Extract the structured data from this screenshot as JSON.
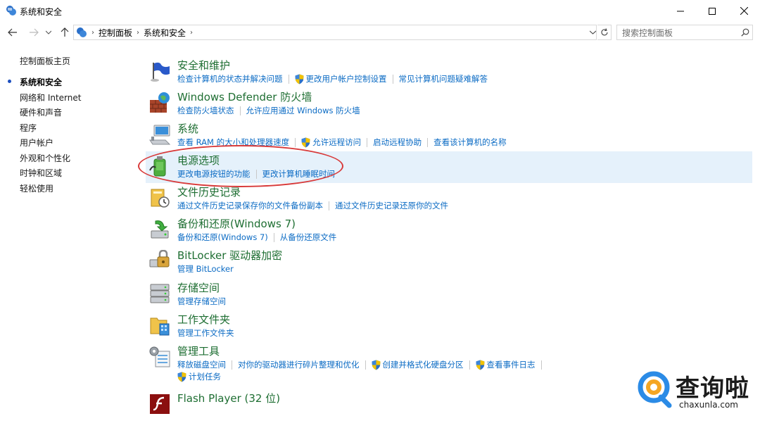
{
  "window": {
    "title": "系统和安全"
  },
  "address": {
    "crumbs": [
      "控制面板",
      "系统和安全"
    ]
  },
  "search": {
    "placeholder": "搜索控制面板"
  },
  "sidebar": {
    "items": [
      {
        "label": "控制面板主页",
        "active": false
      },
      {
        "label": "系统和安全",
        "active": true
      },
      {
        "label": "网络和 Internet",
        "active": false
      },
      {
        "label": "硬件和声音",
        "active": false
      },
      {
        "label": "程序",
        "active": false
      },
      {
        "label": "用户帐户",
        "active": false
      },
      {
        "label": "外观和个性化",
        "active": false
      },
      {
        "label": "时钟和区域",
        "active": false
      },
      {
        "label": "轻松使用",
        "active": false
      }
    ]
  },
  "categories": [
    {
      "icon": "flag-icon",
      "title": "安全和维护",
      "links": [
        {
          "label": "检查计算机的状态并解决问题",
          "shield": false
        },
        {
          "label": "更改用户帐户控制设置",
          "shield": true
        },
        {
          "label": "常见计算机问题疑难解答",
          "shield": false
        }
      ]
    },
    {
      "icon": "firewall-icon",
      "title": "Windows Defender 防火墙",
      "links": [
        {
          "label": "检查防火墙状态",
          "shield": false
        },
        {
          "label": "允许应用通过 Windows 防火墙",
          "shield": false
        }
      ]
    },
    {
      "icon": "computer-icon",
      "title": "系统",
      "links": [
        {
          "label": "查看 RAM 的大小和处理器速度",
          "shield": false
        },
        {
          "label": "允许远程访问",
          "shield": true
        },
        {
          "label": "启动远程协助",
          "shield": false
        },
        {
          "label": "查看该计算机的名称",
          "shield": false
        }
      ]
    },
    {
      "icon": "power-icon",
      "title": "电源选项",
      "highlighted": true,
      "links": [
        {
          "label": "更改电源按钮的功能",
          "shield": false
        },
        {
          "label": "更改计算机睡眠时间",
          "shield": false
        }
      ]
    },
    {
      "icon": "file-history-icon",
      "title": "文件历史记录",
      "links": [
        {
          "label": "通过文件历史记录保存你的文件备份副本",
          "shield": false
        },
        {
          "label": "通过文件历史记录还原你的文件",
          "shield": false
        }
      ]
    },
    {
      "icon": "backup-icon",
      "title": "备份和还原(Windows 7)",
      "links": [
        {
          "label": "备份和还原(Windows 7)",
          "shield": false
        },
        {
          "label": "从备份还原文件",
          "shield": false
        }
      ]
    },
    {
      "icon": "bitlocker-icon",
      "title": "BitLocker 驱动器加密",
      "links": [
        {
          "label": "管理 BitLocker",
          "shield": false
        }
      ]
    },
    {
      "icon": "storage-icon",
      "title": "存储空间",
      "links": [
        {
          "label": "管理存储空间",
          "shield": false
        }
      ]
    },
    {
      "icon": "work-folder-icon",
      "title": "工作文件夹",
      "links": [
        {
          "label": "管理工作文件夹",
          "shield": false
        }
      ]
    },
    {
      "icon": "admin-tools-icon",
      "title": "管理工具",
      "links": [
        {
          "label": "释放磁盘空间",
          "shield": false
        },
        {
          "label": "对你的驱动器进行碎片整理和优化",
          "shield": false
        },
        {
          "label": "创建并格式化硬盘分区",
          "shield": true
        },
        {
          "label": "查看事件日志",
          "shield": true
        }
      ],
      "links2": [
        {
          "label": "计划任务",
          "shield": true
        }
      ]
    },
    {
      "icon": "flash-icon",
      "title": "Flash Player (32 位)",
      "links": []
    }
  ],
  "watermark": {
    "text": "查询啦",
    "url": "chaxunla.com"
  },
  "colors": {
    "link": "#0b6bc4",
    "title_green": "#1e6e32",
    "highlight": "#e5f1fb",
    "annotation": "#d83a3a"
  }
}
